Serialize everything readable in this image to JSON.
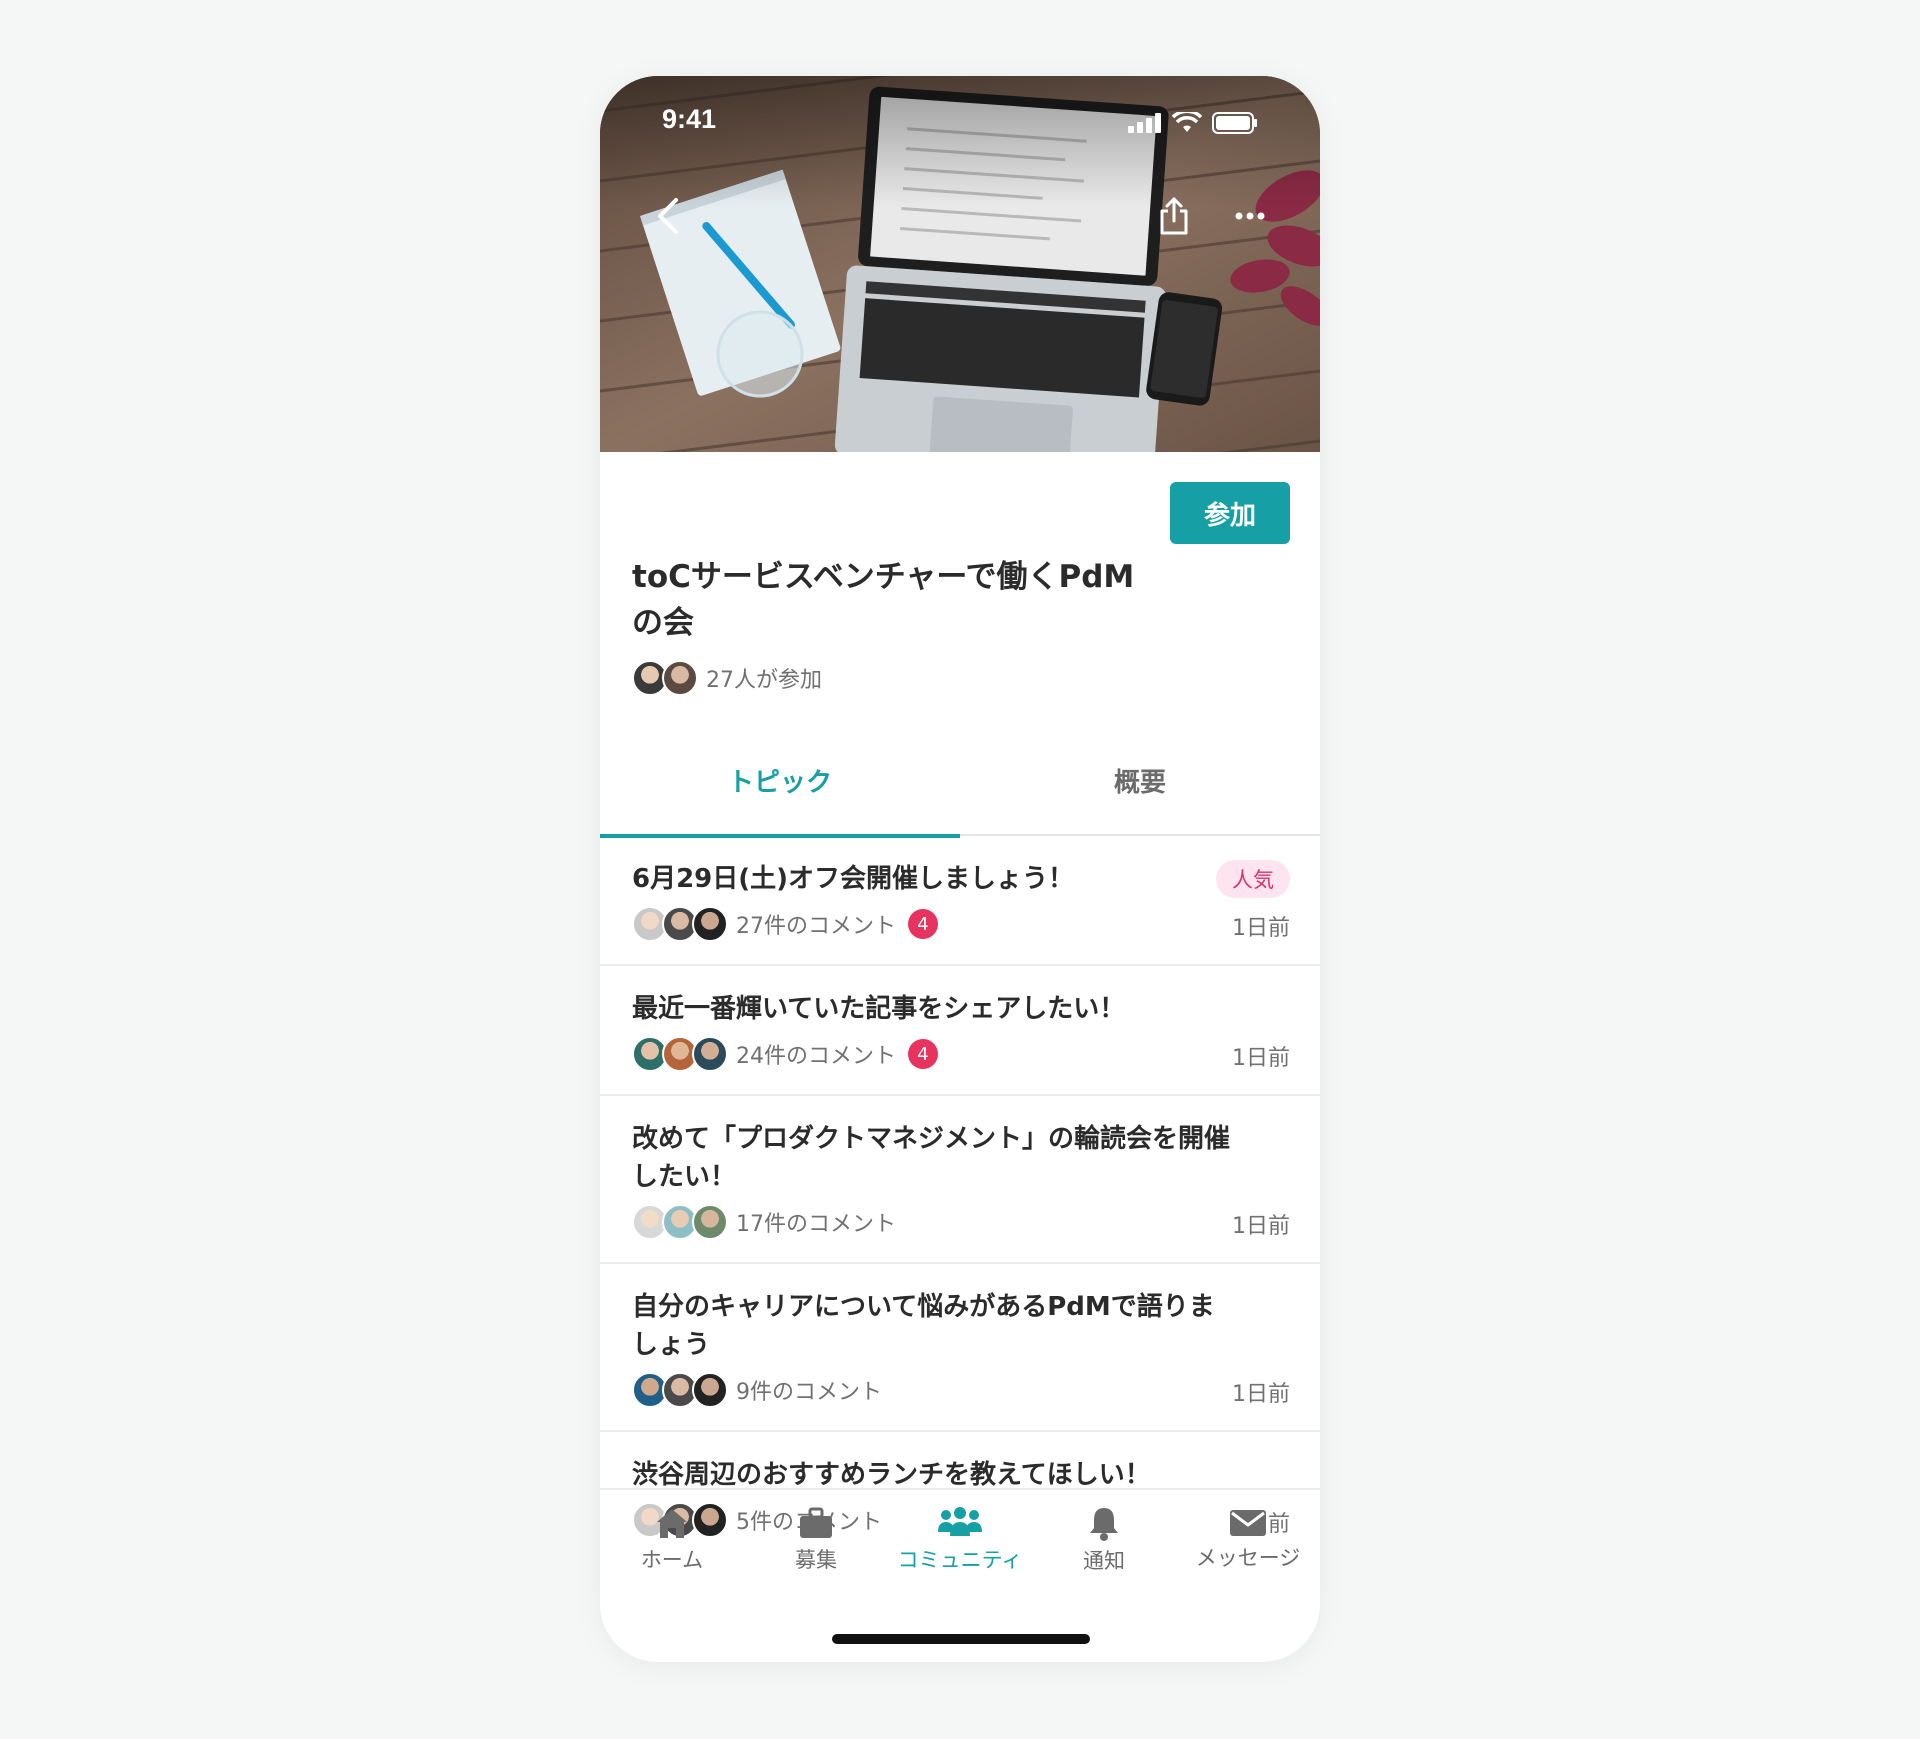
{
  "status_bar": {
    "time": "9:41"
  },
  "hero": {
    "back_icon": "chevron-left-icon",
    "share_icon": "share-icon",
    "more_icon": "more-dots-icon"
  },
  "community": {
    "title": "toCサービスベンチャーで働くPdMの会",
    "join_label": "参加",
    "members_text": "27人が参加"
  },
  "tabs": [
    {
      "label": "トピック",
      "active": true
    },
    {
      "label": "概要",
      "active": false
    }
  ],
  "topics": [
    {
      "title": "6月29日(土)オフ会開催しましょう！",
      "comments": "27件のコメント",
      "badge": "4",
      "time": "1日前",
      "tag": "人気"
    },
    {
      "title": "最近一番輝いていた記事をシェアしたい！",
      "comments": "24件のコメント",
      "badge": "4",
      "time": "1日前"
    },
    {
      "title": "改めて「プロダクトマネジメント」の輪読会を開催したい！",
      "comments": "17件のコメント",
      "time": "1日前"
    },
    {
      "title": "自分のキャリアについて悩みがあるPdMで語りましょう",
      "comments": "9件のコメント",
      "time": "1日前"
    },
    {
      "title": "渋谷周辺のおすすめランチを教えてほしい！",
      "comments": "5件のコメント",
      "time": "1日前"
    }
  ],
  "bottom_nav": [
    {
      "label": "ホーム",
      "icon": "home-icon"
    },
    {
      "label": "募集",
      "icon": "briefcase-icon"
    },
    {
      "label": "コミュニティ",
      "icon": "community-icon",
      "active": true
    },
    {
      "label": "通知",
      "icon": "bell-icon"
    },
    {
      "label": "メッセージ",
      "icon": "mail-icon"
    }
  ],
  "colors": {
    "accent": "#16a0a5",
    "badge": "#e8335f",
    "popular_bg": "#fde4ee",
    "popular_text": "#d6336c"
  }
}
